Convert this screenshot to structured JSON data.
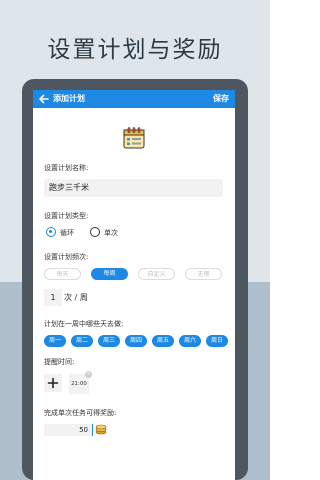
{
  "promo": {
    "title": "设置计划与奖励"
  },
  "header": {
    "title": "添加计划",
    "save_label": "保存"
  },
  "form": {
    "name_label": "设置计划名称:",
    "name_value": "跑步三千米",
    "type_label": "设置计划类型:",
    "type_options": [
      "循环",
      "单次"
    ],
    "type_selected": "循环",
    "freq_label": "设置计划频次:",
    "freq_options": [
      "每天",
      "每周",
      "自定义",
      "无限"
    ],
    "freq_selected": "每周",
    "count_value": "1",
    "count_unit": "次 / 周",
    "days_label": "计划在一周中哪些天去做:",
    "days": [
      "周一",
      "周二",
      "周三",
      "周四",
      "周五",
      "周六",
      "周日"
    ],
    "reminder_label": "提醒时间:",
    "reminder_time": "21:00",
    "reward_label": "完成单次任务可得奖励:",
    "reward_value": "50"
  },
  "colors": {
    "accent": "#1e88e5",
    "device": "#4e5660",
    "bg_top": "#dfe6eb",
    "bg_bottom": "#aebfcb"
  },
  "icons": [
    "back-arrow-icon",
    "calendar-icon",
    "close-icon",
    "plus-icon",
    "coin-icon"
  ]
}
